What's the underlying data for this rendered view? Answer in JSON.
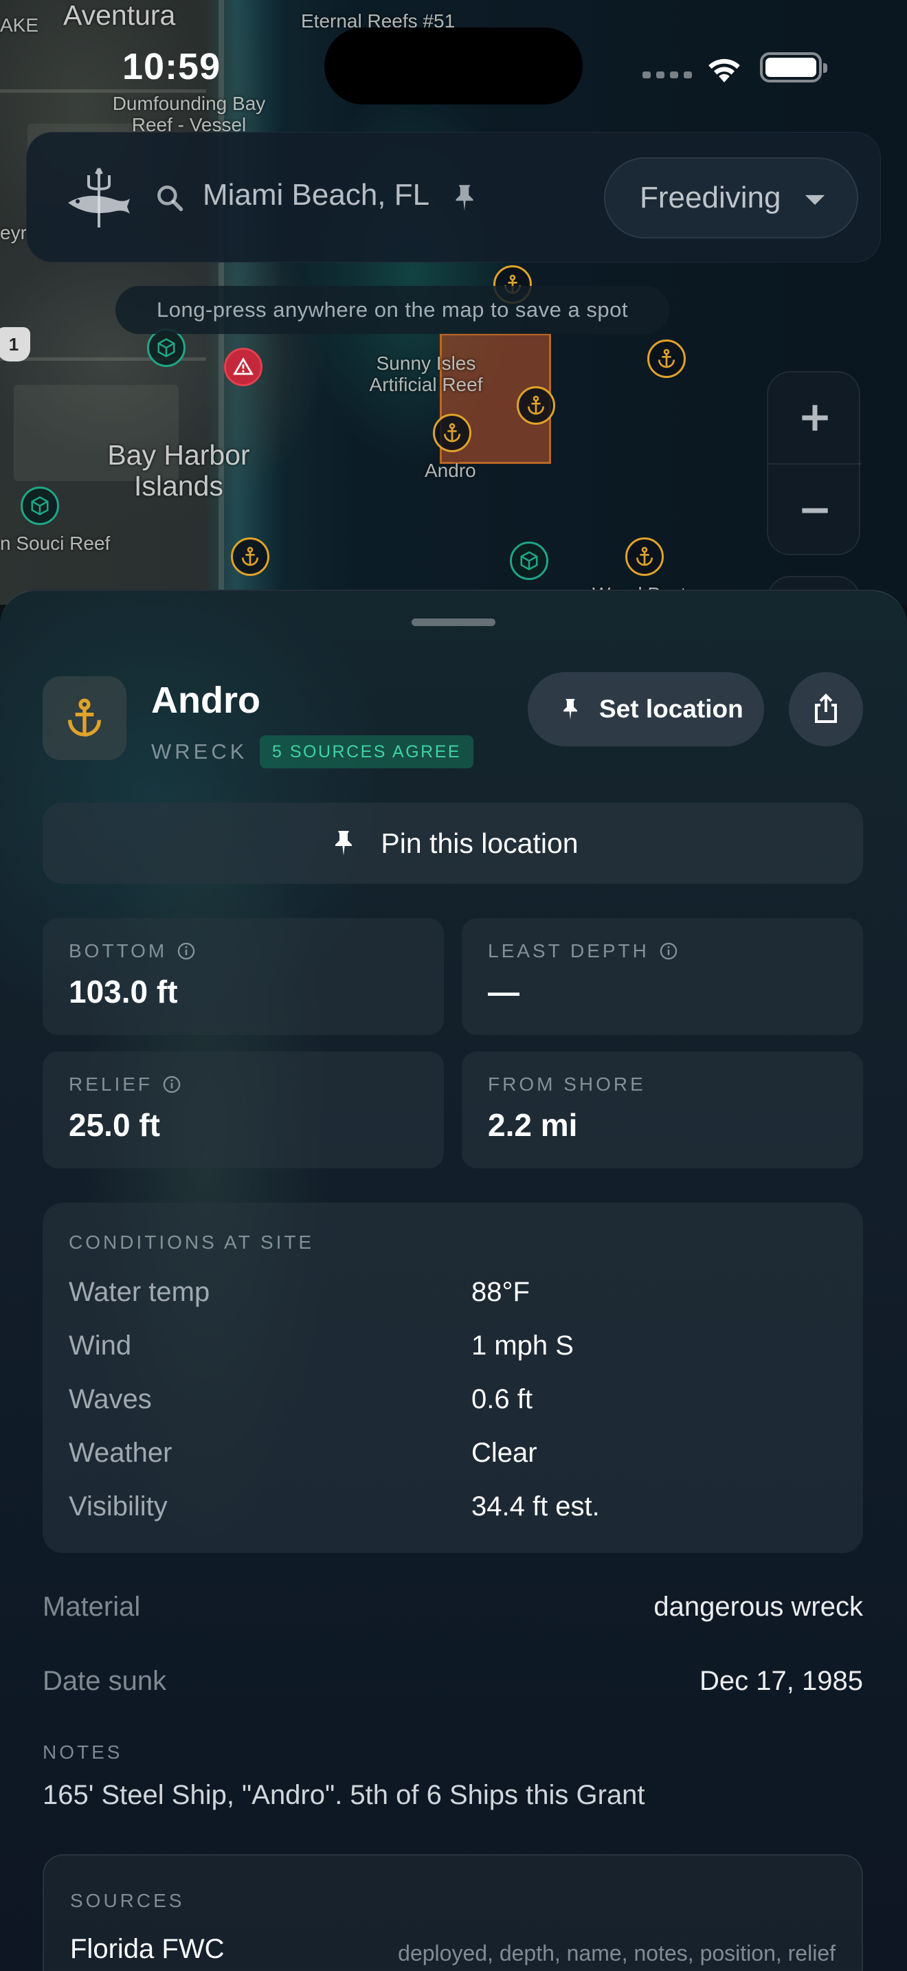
{
  "status_bar": {
    "time": "10:59"
  },
  "map": {
    "labels": {
      "aventura": "Aventura",
      "ake": "AKE",
      "eternal_reefs": "Eternal Reefs #51",
      "dumfounding": "Dumfounding Bay Reef - Vessel",
      "eyr": "eyr",
      "highway": "1",
      "sunny_isles": "Sunny Isles Artificial Reef",
      "bay_harbor": "Bay Harbor Islands",
      "andro": "Andro",
      "souci": "n Souci Reef",
      "wood": "Wood Post"
    },
    "hint": "Long-press anywhere on the map to save a spot"
  },
  "search": {
    "location": "Miami Beach, FL",
    "mode": "Freediving"
  },
  "spot": {
    "name": "Andro",
    "type": "WRECK",
    "agreement": "5 SOURCES AGREE",
    "set_location_label": "Set location",
    "pin_label": "Pin this location",
    "stats": {
      "bottom_label": "BOTTOM",
      "bottom_value": "103.0 ft",
      "least_depth_label": "LEAST DEPTH",
      "least_depth_value": "—",
      "relief_label": "RELIEF",
      "relief_value": "25.0 ft",
      "from_shore_label": "FROM SHORE",
      "from_shore_value": "2.2 mi"
    },
    "conditions": {
      "header": "CONDITIONS AT SITE",
      "rows": [
        {
          "key": "Water temp",
          "value": "88°F"
        },
        {
          "key": "Wind",
          "value": "1 mph S"
        },
        {
          "key": "Waves",
          "value": "0.6 ft"
        },
        {
          "key": "Weather",
          "value": "Clear"
        },
        {
          "key": "Visibility",
          "value": "34.4 ft est."
        }
      ]
    },
    "material_label": "Material",
    "material_value": "dangerous wreck",
    "date_sunk_label": "Date sunk",
    "date_sunk_value": "Dec 17, 1985",
    "notes_label": "NOTES",
    "notes": "165' Steel Ship, \"Andro\". 5th of 6 Ships this Grant",
    "sources": {
      "header": "SOURCES",
      "items": [
        {
          "name": "Florida FWC",
          "fields": "deployed, depth, name, notes, position, relief"
        }
      ]
    }
  },
  "colors": {
    "anchor": "#e0a32a",
    "reef": "#1fa686",
    "hazard": "#c5283a",
    "agree": "#3fd3a4"
  },
  "icons": [
    "trident-fish-logo",
    "search-icon",
    "pin-icon",
    "chevron-down-icon",
    "plus-icon",
    "minus-icon",
    "anchor-icon",
    "share-icon",
    "info-icon",
    "wifi-icon",
    "battery-icon",
    "reef-cube-icon",
    "hazard-triangle-icon"
  ]
}
